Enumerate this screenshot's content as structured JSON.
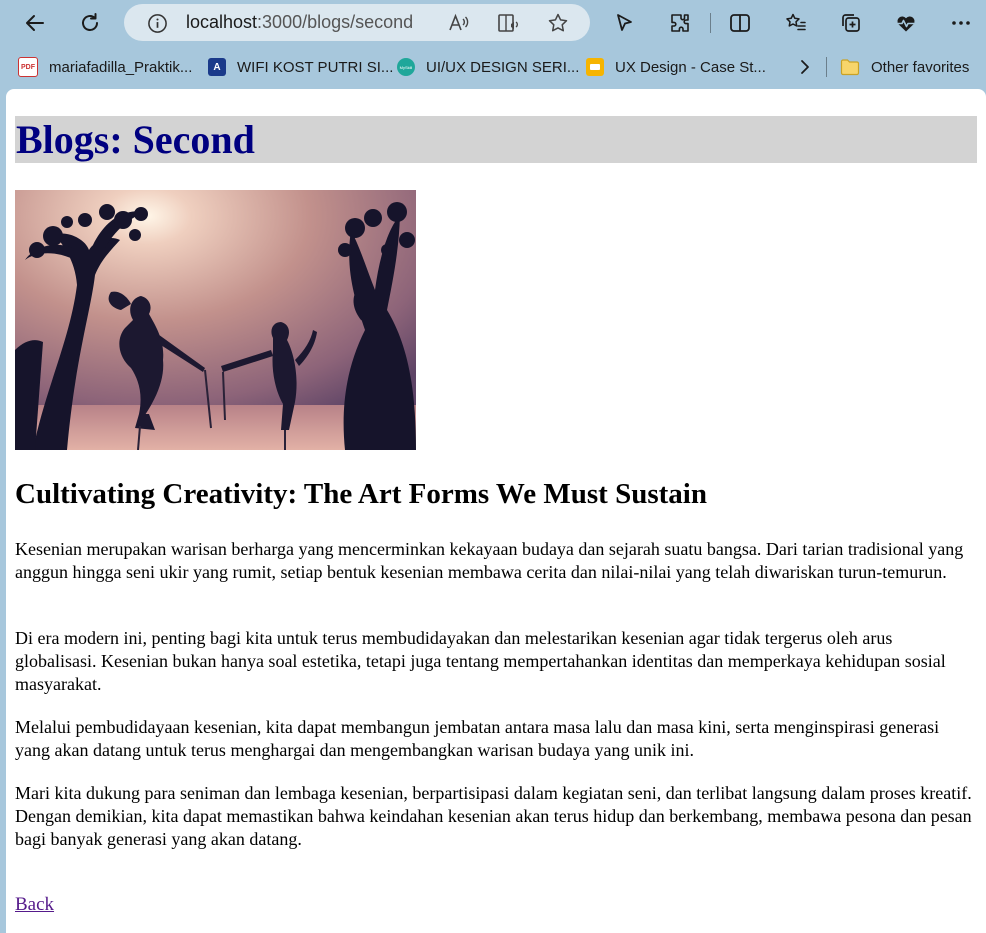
{
  "browser": {
    "url_host": "localhost",
    "url_path": ":3000/blogs/second"
  },
  "favorites": {
    "items": [
      {
        "label": "mariafadilla_Praktik..."
      },
      {
        "label": "WIFI KOST PUTRI SI..."
      },
      {
        "label": "UI/UX DESIGN SERI..."
      },
      {
        "label": "UX Design - Case St..."
      }
    ],
    "other": "Other favorites",
    "icon_texts": {
      "pdf": "PDF",
      "a": "A",
      "myskill": "MySkill"
    }
  },
  "page": {
    "title": "Blogs: Second",
    "heading": "Cultivating Creativity: The Art Forms We Must Sustain",
    "paragraphs": [
      "Kesenian merupakan warisan berharga yang mencerminkan kekayaan budaya dan sejarah suatu bangsa. Dari tarian tradisional yang anggun hingga seni ukir yang rumit, setiap bentuk kesenian membawa cerita dan nilai-nilai yang telah diwariskan turun-temurun.",
      "Di era modern ini, penting bagi kita untuk terus membudidayakan dan melestarikan kesenian agar tidak tergerus oleh arus globalisasi. Kesenian bukan hanya soal estetika, tetapi juga tentang mempertahankan identitas dan memperkaya kehidupan sosial masyarakat.",
      "Melalui pembudidayaan kesenian, kita dapat membangun jembatan antara masa lalu dan masa kini, serta menginspirasi generasi yang akan datang untuk terus menghargai dan mengembangkan warisan budaya yang unik ini.",
      "Mari kita dukung para seniman dan lembaga kesenian, berpartisipasi dalam kegiatan seni, dan terlibat langsung dalam proses kreatif. Dengan demikian, kita dapat memastikan bahwa keindahan kesenian akan terus hidup dan berkembang, membawa pesona dan pesan bagi banyak generasi yang akan datang."
    ],
    "back_label": "Back"
  },
  "colors": {
    "frame": "#a7c7dc",
    "title_text": "#000080",
    "title_bg": "#d3d3d3",
    "link_visited": "#551a8b"
  }
}
